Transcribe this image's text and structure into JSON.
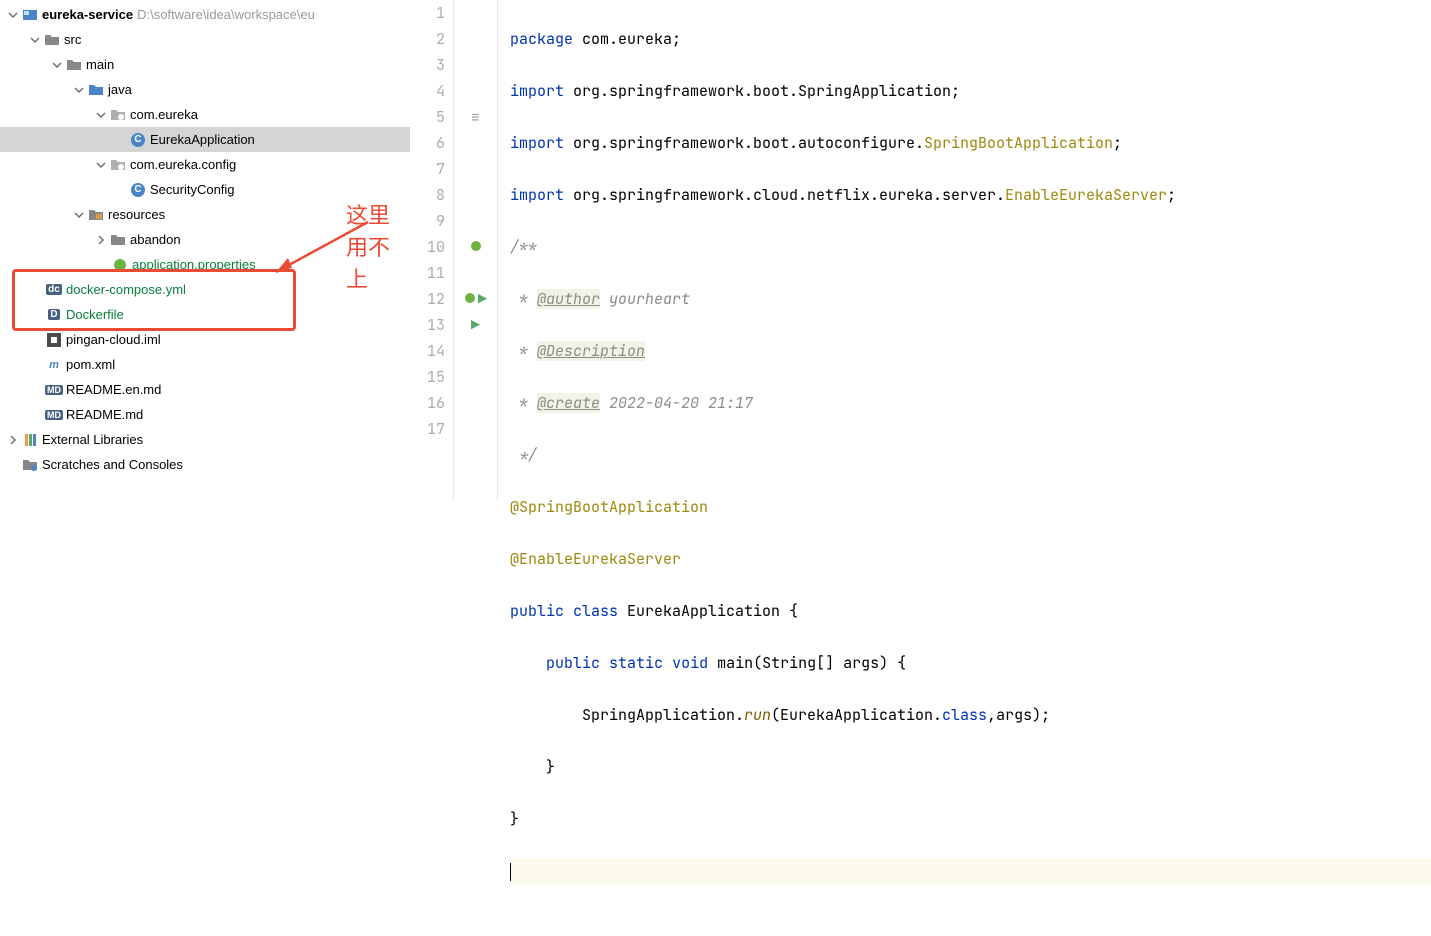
{
  "tree": {
    "root": {
      "name": "eureka-service",
      "path": "D:\\software\\idea\\workspace\\eu"
    },
    "src": "src",
    "main": "main",
    "java": "java",
    "pkg1": "com.eureka",
    "file1": "EurekaApplication",
    "pkg2": "com.eureka.config",
    "file2": "SecurityConfig",
    "resources": "resources",
    "abandon": "abandon",
    "appProps": "application.properties",
    "dockerCompose": "docker-compose.yml",
    "dockerfile": "Dockerfile",
    "iml": "pingan-cloud.iml",
    "pom": "pom.xml",
    "readmeEn": "README.en.md",
    "readme": "README.md",
    "extLib": "External Libraries",
    "scratch": "Scratches and Consoles"
  },
  "annotation": "这里用不上",
  "code": {
    "l1_kw": "package",
    "l1_rest": " com.eureka;",
    "l2_kw": "import",
    "l2_rest": " org.springframework.boot.SpringApplication;",
    "l3_kw": "import",
    "l3_a": " org.springframework.boot.autoconfigure.",
    "l3_cls": "SpringBootApplication",
    "l3_b": ";",
    "l4_kw": "import",
    "l4_a": " org.springframework.cloud.netflix.eureka.server.",
    "l4_cls": "EnableEurekaServer",
    "l4_b": ";",
    "l5": "/**",
    "l6_a": " * ",
    "l6_tag": "@author",
    "l6_b": " yourheart",
    "l7_a": " * ",
    "l7_tag": "@Description",
    "l8_a": " * ",
    "l8_tag": "@create",
    "l8_b": " 2022-04-20 21:17",
    "l9": " */",
    "l10": "@SpringBootApplication",
    "l11": "@EnableEurekaServer",
    "l12_a": "public",
    "l12_b": "class",
    "l12_c": " EurekaApplication {",
    "l13_a": "public",
    "l13_b": "static",
    "l13_c": "void",
    "l13_d": "main",
    "l13_e": "(String[] args) {",
    "l14_a": "        SpringApplication.",
    "l14_b": "run",
    "l14_c": "(EurekaApplication.",
    "l14_d": "class",
    "l14_e": ",args);",
    "l15": "    }",
    "l16": "}",
    "l17": ""
  },
  "lines": [
    "1",
    "2",
    "3",
    "4",
    "5",
    "6",
    "7",
    "8",
    "9",
    "10",
    "11",
    "12",
    "13",
    "14",
    "15",
    "16",
    "17"
  ]
}
